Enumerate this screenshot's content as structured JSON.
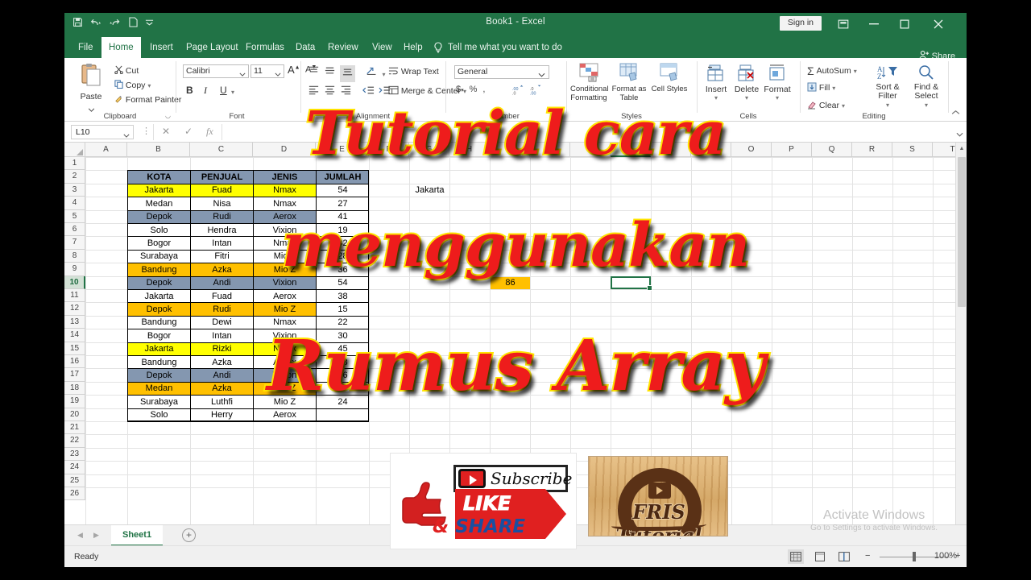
{
  "window": {
    "title": "Book1 - Excel",
    "signin_label": "Sign in",
    "share_label": "Share",
    "quick_access": [
      "save-icon",
      "undo-icon",
      "redo-icon",
      "new-icon",
      "customize-qat-icon"
    ],
    "controls": {
      "ribbon_display": "ribbon-display-options-icon",
      "minimize": "minimize-icon",
      "maximize": "maximize-icon",
      "close": "close-icon"
    }
  },
  "tabs": [
    {
      "label": "File",
      "active": false
    },
    {
      "label": "Home",
      "active": true
    },
    {
      "label": "Insert",
      "active": false
    },
    {
      "label": "Page Layout",
      "active": false
    },
    {
      "label": "Formulas",
      "active": false
    },
    {
      "label": "Data",
      "active": false
    },
    {
      "label": "Review",
      "active": false
    },
    {
      "label": "View",
      "active": false
    },
    {
      "label": "Help",
      "active": false
    }
  ],
  "tellme": {
    "label": "Tell me what you want to do",
    "icon": "lightbulb-icon"
  },
  "ribbon": {
    "clipboard": {
      "group_label": "Clipboard",
      "paste": "Paste",
      "cut": "Cut",
      "copy": "Copy",
      "format_painter": "Format Painter"
    },
    "font": {
      "group_label": "Font",
      "font_name": "Calibri",
      "font_size": "11",
      "grow_font": "A",
      "shrink_font": "A",
      "bold": "B",
      "italic": "I",
      "underline": "U"
    },
    "alignment": {
      "group_label": "Alignment",
      "wrap_text": "Wrap Text",
      "merge_center": "Merge & Center"
    },
    "number": {
      "group_label": "Number",
      "format": "General",
      "percent": "%"
    },
    "styles": {
      "group_label": "Styles",
      "conditional_formatting": "Conditional Formatting",
      "format_as_table": "Format as Table",
      "cell_styles": "Cell Styles"
    },
    "cells": {
      "group_label": "Cells",
      "insert": "Insert",
      "delete": "Delete",
      "format": "Format"
    },
    "editing": {
      "group_label": "Editing",
      "autosum": "AutoSum",
      "fill": "Fill",
      "clear": "Clear",
      "sort_filter": "Sort & Filter",
      "find_select": "Find & Select"
    }
  },
  "formula_bar": {
    "name_box": "L10",
    "formula": "",
    "cancel_icon": "cancel-icon",
    "enter_icon": "enter-icon",
    "insert_function_icon": "fx-icon"
  },
  "grid": {
    "columns": [
      "A",
      "B",
      "C",
      "D",
      "E",
      "F",
      "G",
      "H",
      "I",
      "J",
      "K",
      "L",
      "M",
      "N",
      "O",
      "P",
      "Q",
      "R",
      "S",
      "T"
    ],
    "selected_column": "L",
    "selected_row": 10,
    "rows": [
      1,
      2,
      3,
      4,
      5,
      6,
      7,
      8,
      9,
      10,
      11,
      12,
      13,
      14,
      15,
      16,
      17,
      18,
      19,
      20,
      21,
      22,
      23,
      24,
      25,
      26
    ],
    "table": {
      "headers": [
        "KOTA",
        "PENJUAL",
        "JENIS",
        "JUMLAH"
      ],
      "header_row": 2,
      "rows": [
        {
          "row": 3,
          "kota": "Jakarta",
          "penjual": "Fuad",
          "jenis": "Nmax",
          "jumlah": "54",
          "fill": "yellow"
        },
        {
          "row": 4,
          "kota": "Medan",
          "penjual": "Nisa",
          "jenis": "Nmax",
          "jumlah": "27",
          "fill": "none"
        },
        {
          "row": 5,
          "kota": "Depok",
          "penjual": "Rudi",
          "jenis": "Aerox",
          "jumlah": "41",
          "fill": "blue"
        },
        {
          "row": 6,
          "kota": "Solo",
          "penjual": "Hendra",
          "jenis": "Vixion",
          "jumlah": "19",
          "fill": "none"
        },
        {
          "row": 7,
          "kota": "Bogor",
          "penjual": "Intan",
          "jenis": "Nmax",
          "jumlah": "32",
          "fill": "none"
        },
        {
          "row": 8,
          "kota": "Surabaya",
          "penjual": "Fitri",
          "jenis": "Mio Z",
          "jumlah": "28",
          "fill": "none"
        },
        {
          "row": 9,
          "kota": "Bandung",
          "penjual": "Azka",
          "jenis": "Mio Z",
          "jumlah": "36",
          "fill": "orange"
        },
        {
          "row": 10,
          "kota": "Depok",
          "penjual": "Andi",
          "jenis": "Vixion",
          "jumlah": "54",
          "fill": "blue"
        },
        {
          "row": 11,
          "kota": "Jakarta",
          "penjual": "Fuad",
          "jenis": "Aerox",
          "jumlah": "38",
          "fill": "none"
        },
        {
          "row": 12,
          "kota": "Depok",
          "penjual": "Rudi",
          "jenis": "Mio Z",
          "jumlah": "15",
          "fill": "orange"
        },
        {
          "row": 13,
          "kota": "Bandung",
          "penjual": "Dewi",
          "jenis": "Nmax",
          "jumlah": "22",
          "fill": "none"
        },
        {
          "row": 14,
          "kota": "Bogor",
          "penjual": "Intan",
          "jenis": "Vixion",
          "jumlah": "30",
          "fill": "none"
        },
        {
          "row": 15,
          "kota": "Jakarta",
          "penjual": "Rizki",
          "jenis": "Nmax",
          "jumlah": "45",
          "fill": "yellow"
        },
        {
          "row": 16,
          "kota": "Bandung",
          "penjual": "Azka",
          "jenis": "Aerox",
          "jumlah": "18",
          "fill": "none"
        },
        {
          "row": 17,
          "kota": "Depok",
          "penjual": "Andi",
          "jenis": "Vixion",
          "jumlah": "26",
          "fill": "blue"
        },
        {
          "row": 18,
          "kota": "Medan",
          "penjual": "Azka",
          "jenis": "Mio Z",
          "jumlah": "35",
          "fill": "orange"
        },
        {
          "row": 19,
          "kota": "Surabaya",
          "penjual": "Luthfi",
          "jenis": "Mio Z",
          "jumlah": "24",
          "fill": "none"
        },
        {
          "row": 20,
          "kota": "Solo",
          "penjual": "Herry",
          "jenis": "Aerox",
          "jumlah": "",
          "fill": "none"
        }
      ]
    },
    "side_cells": [
      {
        "ref": "G3",
        "value": "Jakarta",
        "fill": "none"
      },
      {
        "ref": "I10",
        "value": "86",
        "fill": "orange"
      }
    ],
    "colors": {
      "header_fill": "#8497b0",
      "yellow_fill": "#ffff00",
      "orange_fill": "#ffc000",
      "blue_fill": "#8497b0",
      "accent": "#217346"
    }
  },
  "sheet_tabs": {
    "sheets": [
      "Sheet1"
    ],
    "active": "Sheet1",
    "add_label": "+"
  },
  "status_bar": {
    "status": "Ready",
    "views": [
      "normal-view-icon",
      "page-layout-view-icon",
      "page-break-view-icon"
    ],
    "active_view": "normal-view-icon",
    "zoom_out": "−",
    "zoom_in": "+",
    "zoom": "100%"
  },
  "watermark": {
    "line1": "Activate Windows",
    "line2": "Go to Settings to activate Windows."
  },
  "overlay": {
    "line1": "Tutorial cara",
    "line2": "menggunakan",
    "line3": "Rumus Array"
  },
  "subscribe_banner": {
    "subscribe": "Subscribe",
    "like": "LIKE",
    "share_amp": "&",
    "share": "SHARE"
  },
  "logo": {
    "text": "FRIS Tutorial"
  }
}
